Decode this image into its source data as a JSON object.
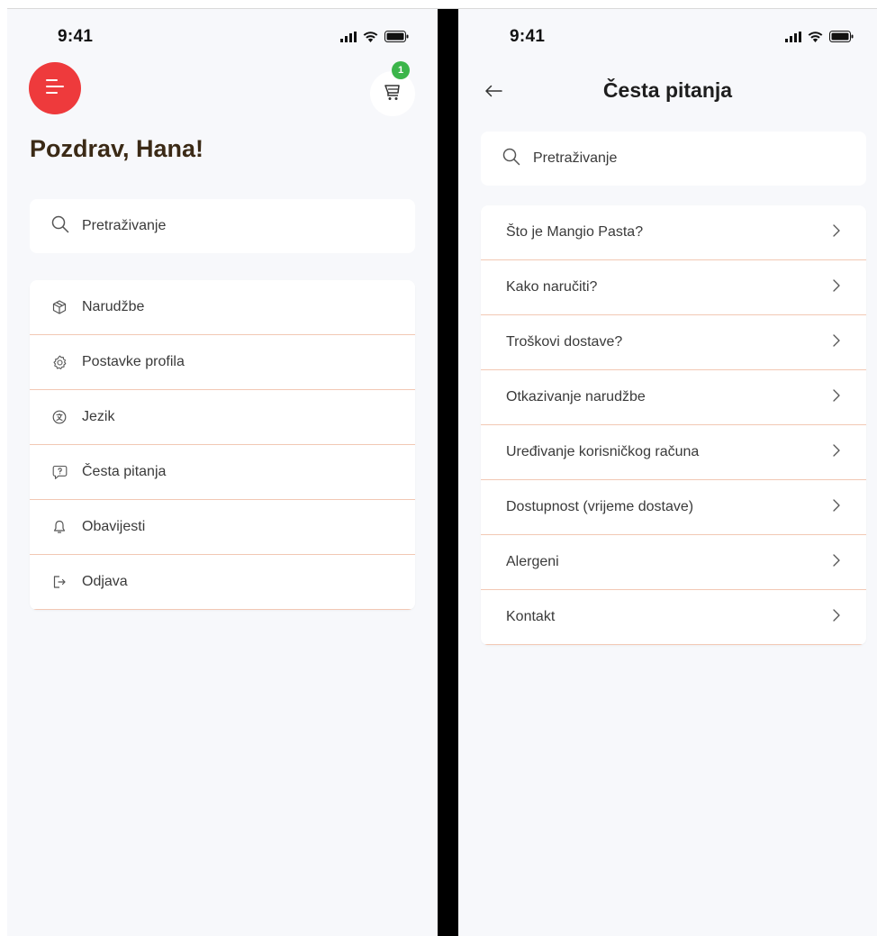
{
  "left_screen": {
    "status_time": "9:41",
    "cart_badge_count": "1",
    "greeting": "Pozdrav, Hana!",
    "search_placeholder": "Pretraživanje",
    "menu_items": [
      {
        "label": "Narudžbe",
        "icon": "box-icon"
      },
      {
        "label": "Postavke profila",
        "icon": "gear-icon"
      },
      {
        "label": "Jezik",
        "icon": "language-icon"
      },
      {
        "label": "Česta pitanja",
        "icon": "question-bubble-icon"
      },
      {
        "label": "Obavijesti",
        "icon": "bell-icon"
      },
      {
        "label": "Odjava",
        "icon": "logout-icon"
      }
    ]
  },
  "right_screen": {
    "status_time": "9:41",
    "title": "Česta pitanja",
    "search_placeholder": "Pretraživanje",
    "faq_items": [
      {
        "label": "Što je Mangio Pasta?"
      },
      {
        "label": "Kako naručiti?"
      },
      {
        "label": "Troškovi dostave?"
      },
      {
        "label": "Otkazivanje narudžbe"
      },
      {
        "label": "Uređivanje korisničkog računa"
      },
      {
        "label": "Dostupnost (vrijeme dostave)"
      },
      {
        "label": "Alergeni"
      },
      {
        "label": "Kontakt"
      }
    ]
  },
  "colors": {
    "accent_red": "#ee3a3c",
    "badge_green": "#3bb54a",
    "divider_peach": "#f2c8b4",
    "background": "#f7f8fb"
  }
}
